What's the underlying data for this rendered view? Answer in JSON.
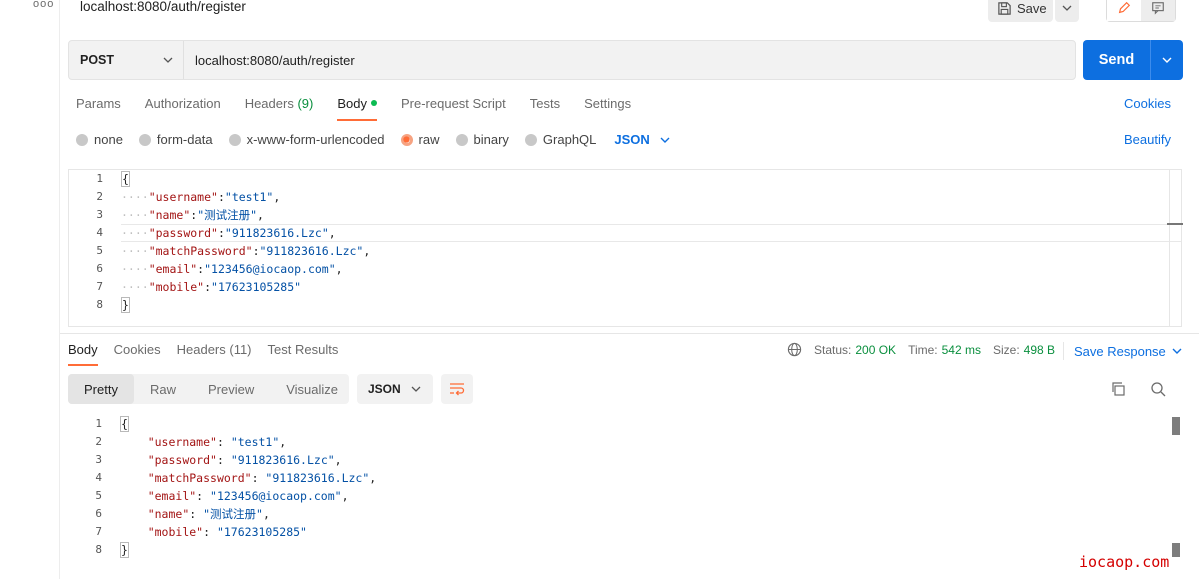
{
  "window": {
    "title": "localhost:8080/auth/register",
    "dots": "ooo"
  },
  "toolbar": {
    "save_label": "Save"
  },
  "request": {
    "method": "POST",
    "url": "localhost:8080/auth/register",
    "send_label": "Send"
  },
  "req_tabs": {
    "params": "Params",
    "authorization": "Authorization",
    "headers": "Headers",
    "headers_count": "(9)",
    "body": "Body",
    "prerequest": "Pre-request Script",
    "tests": "Tests",
    "settings": "Settings",
    "cookies": "Cookies"
  },
  "body_types": {
    "none": "none",
    "form_data": "form-data",
    "urlencoded": "x-www-form-urlencoded",
    "raw": "raw",
    "binary": "binary",
    "graphql": "GraphQL",
    "format": "JSON",
    "beautify": "Beautify"
  },
  "request_body": {
    "lines": [
      "1",
      "2",
      "3",
      "4",
      "5",
      "6",
      "7",
      "8"
    ],
    "open": "{",
    "close": "}",
    "fields": [
      {
        "key": "\"username\"",
        "val": "\"test1\"",
        "sep": ","
      },
      {
        "key": "\"name\"",
        "val": "\"测试注册\"",
        "sep": ","
      },
      {
        "key": "\"password\"",
        "val": "\"911823616.Lzc\"",
        "sep": ","
      },
      {
        "key": "\"matchPassword\"",
        "val": "\"911823616.Lzc\"",
        "sep": ","
      },
      {
        "key": "\"email\"",
        "val": "\"123456@iocaop.com\"",
        "sep": ","
      },
      {
        "key": "\"mobile\"",
        "val": "\"17623105285\"",
        "sep": ""
      }
    ]
  },
  "resp_tabs": {
    "body": "Body",
    "cookies": "Cookies",
    "headers": "Headers (11)",
    "test_results": "Test Results"
  },
  "status": {
    "status_label": "Status:",
    "status_value": "200 OK",
    "time_label": "Time:",
    "time_value": "542 ms",
    "size_label": "Size:",
    "size_value": "498 B",
    "save_response": "Save Response"
  },
  "view_modes": {
    "pretty": "Pretty",
    "raw": "Raw",
    "preview": "Preview",
    "visualize": "Visualize",
    "format": "JSON"
  },
  "response_body": {
    "lines": [
      "1",
      "2",
      "3",
      "4",
      "5",
      "6",
      "7",
      "8"
    ],
    "open": "{",
    "close": "}",
    "fields": [
      {
        "key": "\"username\"",
        "val": "\"test1\"",
        "sep": ","
      },
      {
        "key": "\"password\"",
        "val": "\"911823616.Lzc\"",
        "sep": ","
      },
      {
        "key": "\"matchPassword\"",
        "val": "\"911823616.Lzc\"",
        "sep": ","
      },
      {
        "key": "\"email\"",
        "val": "\"123456@iocaop.com\"",
        "sep": ","
      },
      {
        "key": "\"name\"",
        "val": "\"测试注册\"",
        "sep": ","
      },
      {
        "key": "\"mobile\"",
        "val": "\"17623105285\"",
        "sep": ""
      }
    ]
  },
  "watermark": "iocaop.com",
  "colors": {
    "accent": "#ff6c37",
    "primary": "#0d6fe0",
    "success": "#0a8f3e"
  }
}
